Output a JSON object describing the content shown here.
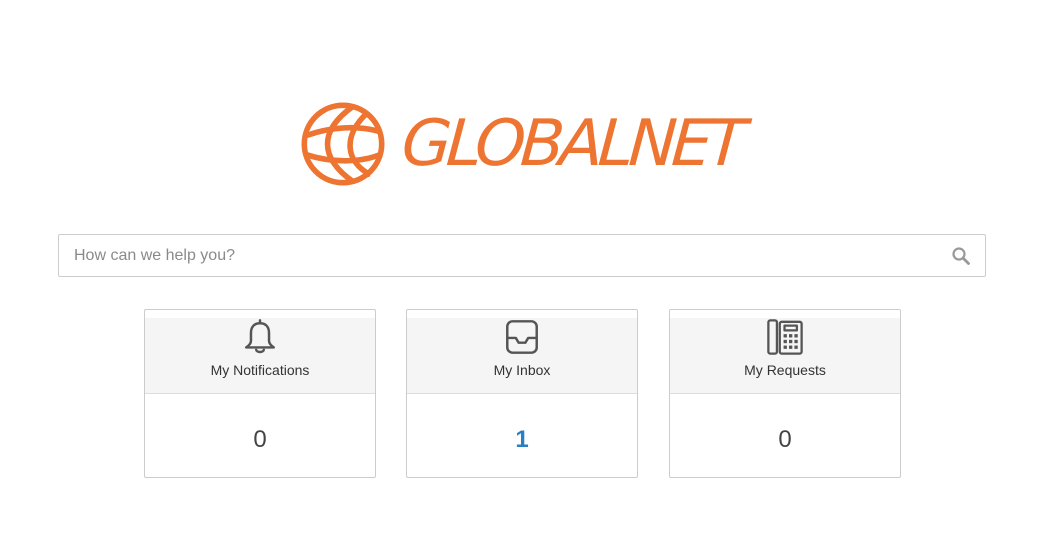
{
  "brand": {
    "name": "GLOBALNET",
    "logo_icon": "globe-icon",
    "color": "#ee7431"
  },
  "search": {
    "placeholder": "How can we help you?",
    "value": "",
    "icon": "search-icon"
  },
  "cards": [
    {
      "label": "My Notifications",
      "count": "0",
      "icon": "bell-icon"
    },
    {
      "label": "My Inbox",
      "count": "1",
      "icon": "inbox-icon",
      "count_color": "#2a7fc4"
    },
    {
      "label": "My Requests",
      "count": "0",
      "icon": "phone-icon"
    }
  ]
}
